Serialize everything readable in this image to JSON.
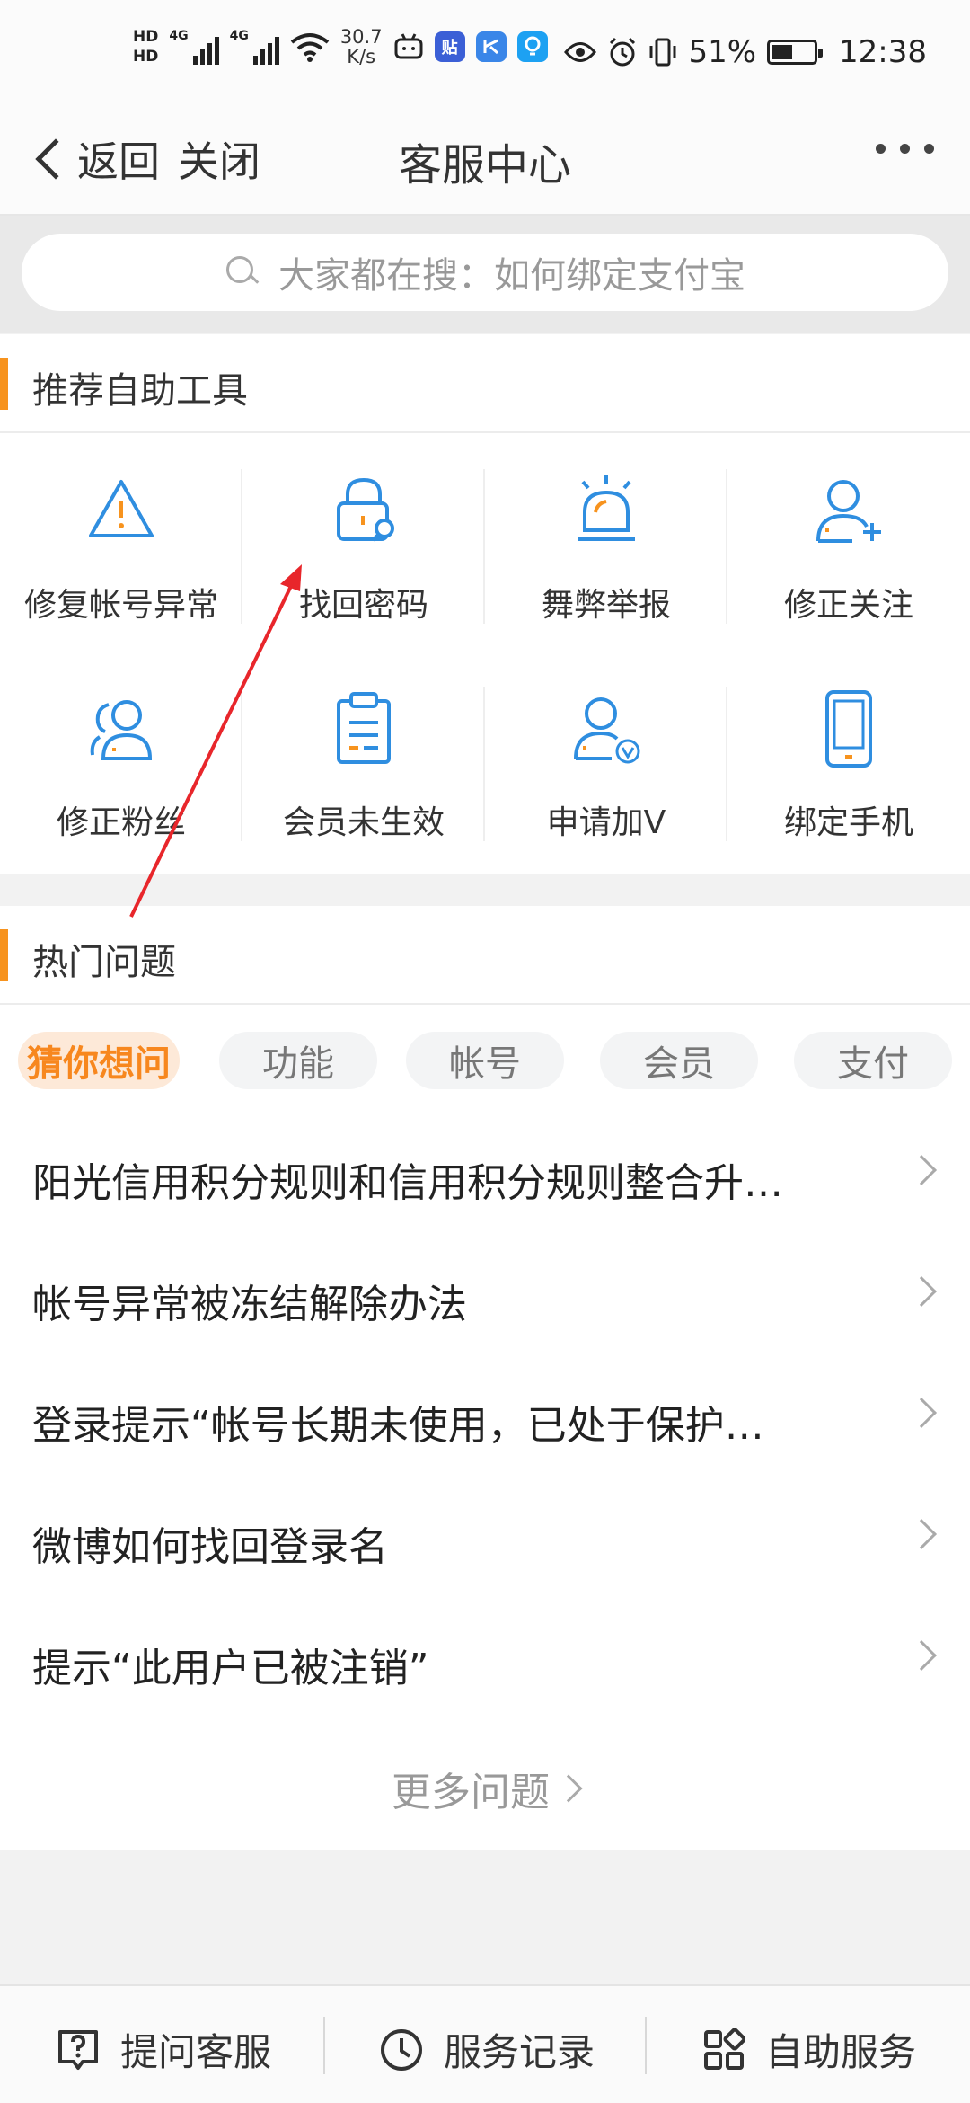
{
  "status_bar": {
    "hd1": "HD",
    "hd2": "HD",
    "net1": "4G",
    "net2": "4G",
    "speed_value": "30.7",
    "speed_unit": "K/s",
    "app_icon_tieba": "贴",
    "battery_percent": "51%",
    "battery_level": 0.51,
    "time": "12:38"
  },
  "nav": {
    "back_label": "返回",
    "close_label": "关闭",
    "title": "客服中心"
  },
  "search": {
    "placeholder": "大家都在搜：如何绑定支付宝"
  },
  "tools_section": {
    "title": "推荐自助工具",
    "items": [
      {
        "label": "修复帐号异常",
        "icon": "warning-triangle-icon"
      },
      {
        "label": "找回密码",
        "icon": "lock-search-icon"
      },
      {
        "label": "舞弊举报",
        "icon": "alarm-siren-icon"
      },
      {
        "label": "修正关注",
        "icon": "user-add-icon"
      },
      {
        "label": "修正粉丝",
        "icon": "users-icon"
      },
      {
        "label": "会员未生效",
        "icon": "clipboard-icon"
      },
      {
        "label": "申请加V",
        "icon": "user-verified-icon"
      },
      {
        "label": "绑定手机",
        "icon": "mobile-phone-icon"
      }
    ]
  },
  "hot_section": {
    "title": "热门问题",
    "tabs": [
      "猜你想问",
      "功能",
      "帐号",
      "会员",
      "支付"
    ],
    "active_tab": 0,
    "questions": [
      "阳光信用积分规则和信用积分规则整合升…",
      "帐号异常被冻结解除办法",
      "登录提示“帐号长期未使用，已处于保护…",
      "微博如何找回登录名",
      "提示“此用户已被注销”"
    ],
    "more_label": "更多问题"
  },
  "bottom_bar": {
    "ask_label": "提问客服",
    "records_label": "服务记录",
    "self_service_label": "自助服务"
  },
  "colors": {
    "accent": "#f7931e",
    "icon_blue": "#2f8ee0",
    "icon_orange": "#f7931e",
    "annotation_red": "#e8262b"
  }
}
